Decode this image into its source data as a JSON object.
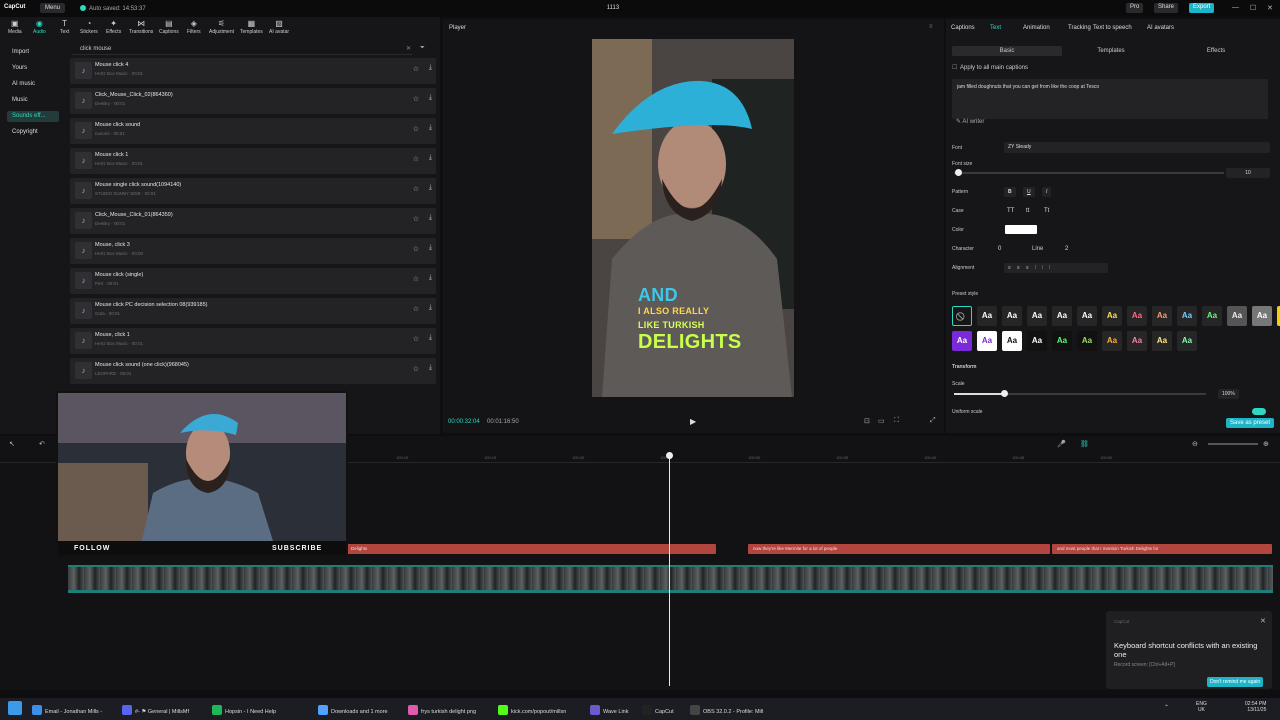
{
  "titlebar": {
    "logo": "CapCut",
    "menu": "Menu",
    "saved": "Auto saved: 14:53:37",
    "project": "1113",
    "pro": "Pro",
    "share": "Share",
    "export": "Export"
  },
  "toolbar": [
    "Media",
    "Audio",
    "Text",
    "Stickers",
    "Effects",
    "Transitions",
    "Captions",
    "Filters",
    "Adjustment",
    "Templates",
    "AI avatar"
  ],
  "sidebar": [
    "Import",
    "Yours",
    "AI music",
    "Music",
    "Sounds eff...",
    "Copyright"
  ],
  "search": "click mouse",
  "sounds": [
    {
      "name": "Mouse click 4",
      "sub": "Hertz Box Music · 00:01"
    },
    {
      "name": "Click_Mouse_Click_02(864360)",
      "sub": "DeeBry · 00:01"
    },
    {
      "name": "Mouse click sound",
      "sub": "nusomi · 00:01"
    },
    {
      "name": "Mouse click 1",
      "sub": "Hertz Box Music · 00:01"
    },
    {
      "name": "Mouse single click sound(1094140)",
      "sub": "STUDIO SUNNY SIDE · 00:01"
    },
    {
      "name": "Click_Mouse_Click_01(864359)",
      "sub": "DeeBry · 00:01"
    },
    {
      "name": "Mouse, click 3",
      "sub": "Hertz Box Music · 00:00"
    },
    {
      "name": "Mouse click (single)",
      "sub": "Pert · 00:01"
    },
    {
      "name": "Mouse click PC decision selection 08(939185)",
      "sub": "Gota · 00:01"
    },
    {
      "name": "Mouse, click 1",
      "sub": "Hertz Box Music · 00:01"
    },
    {
      "name": "Mouse click sound (one click)(968045)",
      "sub": "LEOPARD · 00:01"
    }
  ],
  "player": {
    "label": "Player",
    "time": "00:00:32:04",
    "duration": "00:01:16:50",
    "captions": [
      "AND",
      "I ALSO REALLY",
      "LIKE TURKISH",
      "DELIGHTS"
    ]
  },
  "props": {
    "tabs": [
      "Captions",
      "Text",
      "Animation",
      "Tracking",
      "Text to speech",
      "AI avatars"
    ],
    "subtabs": [
      "Basic",
      "Templates",
      "Effects"
    ],
    "apply": "Apply to all main captions",
    "text": "jam filled doughnuts that you can get from like the coop at Tesco",
    "ai_writer": "AI writer",
    "font_label": "Font",
    "font": "ZY Steady",
    "size_label": "Font size",
    "size": "10",
    "pattern_label": "Pattern",
    "case_label": "Case",
    "color_label": "Color",
    "char_label": "Character",
    "char": "0",
    "line_label": "Line",
    "line": "2",
    "align_label": "Alignment",
    "preset_label": "Preset style",
    "preset_text": "Aa",
    "transform": "Transform",
    "scale_label": "Scale",
    "scale": "100%",
    "uniform": "Uniform scale",
    "save_preset": "Save as preset"
  },
  "timeline": {
    "ticks": [
      "100:10",
      "100:15",
      "100:20",
      "100:25",
      "100:30",
      "100:35",
      "100:40",
      "100:45",
      "100:50"
    ],
    "clips": [
      "Delights",
      "now they're like Mermite for a lot of people",
      "and most people that I mention Turkish Delights for"
    ]
  },
  "webcam": {
    "follow": "FOLLOW",
    "subscribe": "SUBSCRIBE"
  },
  "toast": {
    "brand": "CapCut",
    "title": "Keyboard shortcut conflicts with an existing one",
    "sub": "Record screen: [Ctrl+Alt+P]",
    "button": "Don't remind me again"
  },
  "taskbar": {
    "items": [
      "Email - Jonathan Mills -",
      "#- ⚑ General | MillsMf",
      "Hopsin - I Need Help",
      "Downloads and 1 more",
      "frys turkish delight png",
      "kick.com/popout/millsn",
      "Wave Link",
      "CapCut",
      "OBS 32.0.2 - Profile: Mill"
    ],
    "lang": "ENG",
    "region": "UK",
    "time": "02:54 PM",
    "date": "13/11/25"
  }
}
